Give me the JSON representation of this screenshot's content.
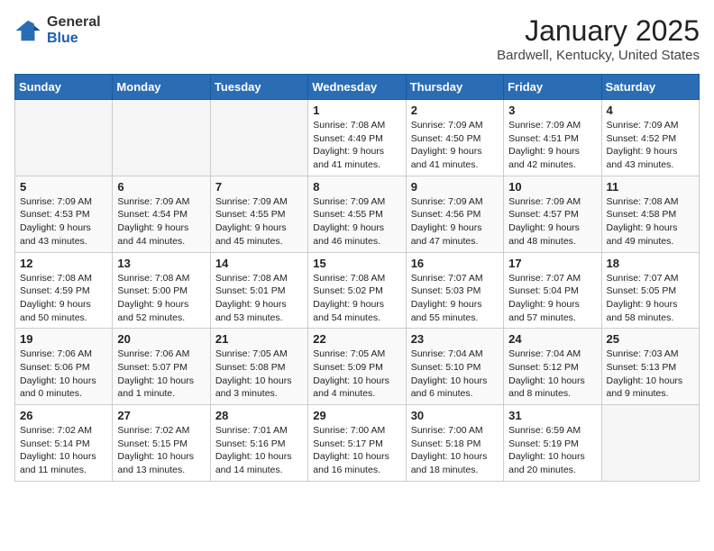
{
  "header": {
    "logo_general": "General",
    "logo_blue": "Blue",
    "month_title": "January 2025",
    "location": "Bardwell, Kentucky, United States"
  },
  "days_of_week": [
    "Sunday",
    "Monday",
    "Tuesday",
    "Wednesday",
    "Thursday",
    "Friday",
    "Saturday"
  ],
  "weeks": [
    [
      {
        "day": "",
        "info": ""
      },
      {
        "day": "",
        "info": ""
      },
      {
        "day": "",
        "info": ""
      },
      {
        "day": "1",
        "info": "Sunrise: 7:08 AM\nSunset: 4:49 PM\nDaylight: 9 hours and 41 minutes."
      },
      {
        "day": "2",
        "info": "Sunrise: 7:09 AM\nSunset: 4:50 PM\nDaylight: 9 hours and 41 minutes."
      },
      {
        "day": "3",
        "info": "Sunrise: 7:09 AM\nSunset: 4:51 PM\nDaylight: 9 hours and 42 minutes."
      },
      {
        "day": "4",
        "info": "Sunrise: 7:09 AM\nSunset: 4:52 PM\nDaylight: 9 hours and 43 minutes."
      }
    ],
    [
      {
        "day": "5",
        "info": "Sunrise: 7:09 AM\nSunset: 4:53 PM\nDaylight: 9 hours and 43 minutes."
      },
      {
        "day": "6",
        "info": "Sunrise: 7:09 AM\nSunset: 4:54 PM\nDaylight: 9 hours and 44 minutes."
      },
      {
        "day": "7",
        "info": "Sunrise: 7:09 AM\nSunset: 4:55 PM\nDaylight: 9 hours and 45 minutes."
      },
      {
        "day": "8",
        "info": "Sunrise: 7:09 AM\nSunset: 4:55 PM\nDaylight: 9 hours and 46 minutes."
      },
      {
        "day": "9",
        "info": "Sunrise: 7:09 AM\nSunset: 4:56 PM\nDaylight: 9 hours and 47 minutes."
      },
      {
        "day": "10",
        "info": "Sunrise: 7:09 AM\nSunset: 4:57 PM\nDaylight: 9 hours and 48 minutes."
      },
      {
        "day": "11",
        "info": "Sunrise: 7:08 AM\nSunset: 4:58 PM\nDaylight: 9 hours and 49 minutes."
      }
    ],
    [
      {
        "day": "12",
        "info": "Sunrise: 7:08 AM\nSunset: 4:59 PM\nDaylight: 9 hours and 50 minutes."
      },
      {
        "day": "13",
        "info": "Sunrise: 7:08 AM\nSunset: 5:00 PM\nDaylight: 9 hours and 52 minutes."
      },
      {
        "day": "14",
        "info": "Sunrise: 7:08 AM\nSunset: 5:01 PM\nDaylight: 9 hours and 53 minutes."
      },
      {
        "day": "15",
        "info": "Sunrise: 7:08 AM\nSunset: 5:02 PM\nDaylight: 9 hours and 54 minutes."
      },
      {
        "day": "16",
        "info": "Sunrise: 7:07 AM\nSunset: 5:03 PM\nDaylight: 9 hours and 55 minutes."
      },
      {
        "day": "17",
        "info": "Sunrise: 7:07 AM\nSunset: 5:04 PM\nDaylight: 9 hours and 57 minutes."
      },
      {
        "day": "18",
        "info": "Sunrise: 7:07 AM\nSunset: 5:05 PM\nDaylight: 9 hours and 58 minutes."
      }
    ],
    [
      {
        "day": "19",
        "info": "Sunrise: 7:06 AM\nSunset: 5:06 PM\nDaylight: 10 hours and 0 minutes."
      },
      {
        "day": "20",
        "info": "Sunrise: 7:06 AM\nSunset: 5:07 PM\nDaylight: 10 hours and 1 minute."
      },
      {
        "day": "21",
        "info": "Sunrise: 7:05 AM\nSunset: 5:08 PM\nDaylight: 10 hours and 3 minutes."
      },
      {
        "day": "22",
        "info": "Sunrise: 7:05 AM\nSunset: 5:09 PM\nDaylight: 10 hours and 4 minutes."
      },
      {
        "day": "23",
        "info": "Sunrise: 7:04 AM\nSunset: 5:10 PM\nDaylight: 10 hours and 6 minutes."
      },
      {
        "day": "24",
        "info": "Sunrise: 7:04 AM\nSunset: 5:12 PM\nDaylight: 10 hours and 8 minutes."
      },
      {
        "day": "25",
        "info": "Sunrise: 7:03 AM\nSunset: 5:13 PM\nDaylight: 10 hours and 9 minutes."
      }
    ],
    [
      {
        "day": "26",
        "info": "Sunrise: 7:02 AM\nSunset: 5:14 PM\nDaylight: 10 hours and 11 minutes."
      },
      {
        "day": "27",
        "info": "Sunrise: 7:02 AM\nSunset: 5:15 PM\nDaylight: 10 hours and 13 minutes."
      },
      {
        "day": "28",
        "info": "Sunrise: 7:01 AM\nSunset: 5:16 PM\nDaylight: 10 hours and 14 minutes."
      },
      {
        "day": "29",
        "info": "Sunrise: 7:00 AM\nSunset: 5:17 PM\nDaylight: 10 hours and 16 minutes."
      },
      {
        "day": "30",
        "info": "Sunrise: 7:00 AM\nSunset: 5:18 PM\nDaylight: 10 hours and 18 minutes."
      },
      {
        "day": "31",
        "info": "Sunrise: 6:59 AM\nSunset: 5:19 PM\nDaylight: 10 hours and 20 minutes."
      },
      {
        "day": "",
        "info": ""
      }
    ]
  ]
}
